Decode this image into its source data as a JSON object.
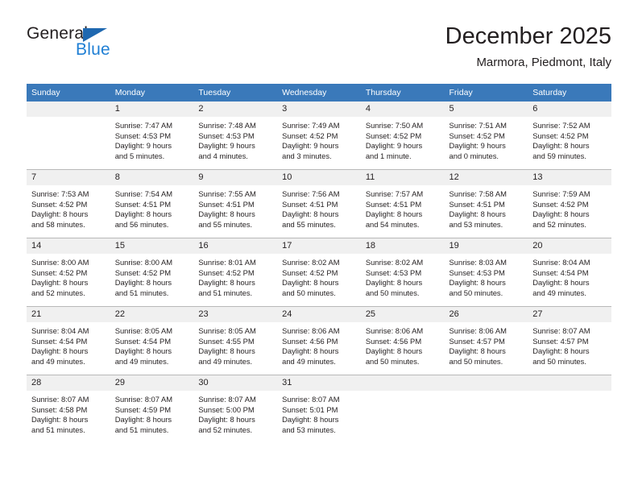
{
  "brand": {
    "name_top": "General",
    "name_bottom": "Blue",
    "triangle_color": "#1f68b0",
    "blue_text_color": "#1f7fd4"
  },
  "header": {
    "title": "December 2025",
    "subtitle": "Marmora, Piedmont, Italy"
  },
  "theme": {
    "header_bg": "#3a79ba",
    "daynum_bg": "#f0f0f0",
    "text_color": "#231f20",
    "grid_line": "#b9b9b9"
  },
  "weekdays": [
    "Sunday",
    "Monday",
    "Tuesday",
    "Wednesday",
    "Thursday",
    "Friday",
    "Saturday"
  ],
  "weeks": [
    [
      {
        "day": "",
        "sunrise": "",
        "sunset": "",
        "daylight_1": "",
        "daylight_2": "",
        "blank": true
      },
      {
        "day": "1",
        "sunrise": "Sunrise: 7:47 AM",
        "sunset": "Sunset: 4:53 PM",
        "daylight_1": "Daylight: 9 hours",
        "daylight_2": "and 5 minutes."
      },
      {
        "day": "2",
        "sunrise": "Sunrise: 7:48 AM",
        "sunset": "Sunset: 4:53 PM",
        "daylight_1": "Daylight: 9 hours",
        "daylight_2": "and 4 minutes."
      },
      {
        "day": "3",
        "sunrise": "Sunrise: 7:49 AM",
        "sunset": "Sunset: 4:52 PM",
        "daylight_1": "Daylight: 9 hours",
        "daylight_2": "and 3 minutes."
      },
      {
        "day": "4",
        "sunrise": "Sunrise: 7:50 AM",
        "sunset": "Sunset: 4:52 PM",
        "daylight_1": "Daylight: 9 hours",
        "daylight_2": "and 1 minute."
      },
      {
        "day": "5",
        "sunrise": "Sunrise: 7:51 AM",
        "sunset": "Sunset: 4:52 PM",
        "daylight_1": "Daylight: 9 hours",
        "daylight_2": "and 0 minutes."
      },
      {
        "day": "6",
        "sunrise": "Sunrise: 7:52 AM",
        "sunset": "Sunset: 4:52 PM",
        "daylight_1": "Daylight: 8 hours",
        "daylight_2": "and 59 minutes."
      }
    ],
    [
      {
        "day": "7",
        "sunrise": "Sunrise: 7:53 AM",
        "sunset": "Sunset: 4:52 PM",
        "daylight_1": "Daylight: 8 hours",
        "daylight_2": "and 58 minutes."
      },
      {
        "day": "8",
        "sunrise": "Sunrise: 7:54 AM",
        "sunset": "Sunset: 4:51 PM",
        "daylight_1": "Daylight: 8 hours",
        "daylight_2": "and 56 minutes."
      },
      {
        "day": "9",
        "sunrise": "Sunrise: 7:55 AM",
        "sunset": "Sunset: 4:51 PM",
        "daylight_1": "Daylight: 8 hours",
        "daylight_2": "and 55 minutes."
      },
      {
        "day": "10",
        "sunrise": "Sunrise: 7:56 AM",
        "sunset": "Sunset: 4:51 PM",
        "daylight_1": "Daylight: 8 hours",
        "daylight_2": "and 55 minutes."
      },
      {
        "day": "11",
        "sunrise": "Sunrise: 7:57 AM",
        "sunset": "Sunset: 4:51 PM",
        "daylight_1": "Daylight: 8 hours",
        "daylight_2": "and 54 minutes."
      },
      {
        "day": "12",
        "sunrise": "Sunrise: 7:58 AM",
        "sunset": "Sunset: 4:51 PM",
        "daylight_1": "Daylight: 8 hours",
        "daylight_2": "and 53 minutes."
      },
      {
        "day": "13",
        "sunrise": "Sunrise: 7:59 AM",
        "sunset": "Sunset: 4:52 PM",
        "daylight_1": "Daylight: 8 hours",
        "daylight_2": "and 52 minutes."
      }
    ],
    [
      {
        "day": "14",
        "sunrise": "Sunrise: 8:00 AM",
        "sunset": "Sunset: 4:52 PM",
        "daylight_1": "Daylight: 8 hours",
        "daylight_2": "and 52 minutes."
      },
      {
        "day": "15",
        "sunrise": "Sunrise: 8:00 AM",
        "sunset": "Sunset: 4:52 PM",
        "daylight_1": "Daylight: 8 hours",
        "daylight_2": "and 51 minutes."
      },
      {
        "day": "16",
        "sunrise": "Sunrise: 8:01 AM",
        "sunset": "Sunset: 4:52 PM",
        "daylight_1": "Daylight: 8 hours",
        "daylight_2": "and 51 minutes."
      },
      {
        "day": "17",
        "sunrise": "Sunrise: 8:02 AM",
        "sunset": "Sunset: 4:52 PM",
        "daylight_1": "Daylight: 8 hours",
        "daylight_2": "and 50 minutes."
      },
      {
        "day": "18",
        "sunrise": "Sunrise: 8:02 AM",
        "sunset": "Sunset: 4:53 PM",
        "daylight_1": "Daylight: 8 hours",
        "daylight_2": "and 50 minutes."
      },
      {
        "day": "19",
        "sunrise": "Sunrise: 8:03 AM",
        "sunset": "Sunset: 4:53 PM",
        "daylight_1": "Daylight: 8 hours",
        "daylight_2": "and 50 minutes."
      },
      {
        "day": "20",
        "sunrise": "Sunrise: 8:04 AM",
        "sunset": "Sunset: 4:54 PM",
        "daylight_1": "Daylight: 8 hours",
        "daylight_2": "and 49 minutes."
      }
    ],
    [
      {
        "day": "21",
        "sunrise": "Sunrise: 8:04 AM",
        "sunset": "Sunset: 4:54 PM",
        "daylight_1": "Daylight: 8 hours",
        "daylight_2": "and 49 minutes."
      },
      {
        "day": "22",
        "sunrise": "Sunrise: 8:05 AM",
        "sunset": "Sunset: 4:54 PM",
        "daylight_1": "Daylight: 8 hours",
        "daylight_2": "and 49 minutes."
      },
      {
        "day": "23",
        "sunrise": "Sunrise: 8:05 AM",
        "sunset": "Sunset: 4:55 PM",
        "daylight_1": "Daylight: 8 hours",
        "daylight_2": "and 49 minutes."
      },
      {
        "day": "24",
        "sunrise": "Sunrise: 8:06 AM",
        "sunset": "Sunset: 4:56 PM",
        "daylight_1": "Daylight: 8 hours",
        "daylight_2": "and 49 minutes."
      },
      {
        "day": "25",
        "sunrise": "Sunrise: 8:06 AM",
        "sunset": "Sunset: 4:56 PM",
        "daylight_1": "Daylight: 8 hours",
        "daylight_2": "and 50 minutes."
      },
      {
        "day": "26",
        "sunrise": "Sunrise: 8:06 AM",
        "sunset": "Sunset: 4:57 PM",
        "daylight_1": "Daylight: 8 hours",
        "daylight_2": "and 50 minutes."
      },
      {
        "day": "27",
        "sunrise": "Sunrise: 8:07 AM",
        "sunset": "Sunset: 4:57 PM",
        "daylight_1": "Daylight: 8 hours",
        "daylight_2": "and 50 minutes."
      }
    ],
    [
      {
        "day": "28",
        "sunrise": "Sunrise: 8:07 AM",
        "sunset": "Sunset: 4:58 PM",
        "daylight_1": "Daylight: 8 hours",
        "daylight_2": "and 51 minutes."
      },
      {
        "day": "29",
        "sunrise": "Sunrise: 8:07 AM",
        "sunset": "Sunset: 4:59 PM",
        "daylight_1": "Daylight: 8 hours",
        "daylight_2": "and 51 minutes."
      },
      {
        "day": "30",
        "sunrise": "Sunrise: 8:07 AM",
        "sunset": "Sunset: 5:00 PM",
        "daylight_1": "Daylight: 8 hours",
        "daylight_2": "and 52 minutes."
      },
      {
        "day": "31",
        "sunrise": "Sunrise: 8:07 AM",
        "sunset": "Sunset: 5:01 PM",
        "daylight_1": "Daylight: 8 hours",
        "daylight_2": "and 53 minutes."
      },
      {
        "day": "",
        "sunrise": "",
        "sunset": "",
        "daylight_1": "",
        "daylight_2": "",
        "blank": true
      },
      {
        "day": "",
        "sunrise": "",
        "sunset": "",
        "daylight_1": "",
        "daylight_2": "",
        "blank": true
      },
      {
        "day": "",
        "sunrise": "",
        "sunset": "",
        "daylight_1": "",
        "daylight_2": "",
        "blank": true
      }
    ]
  ]
}
